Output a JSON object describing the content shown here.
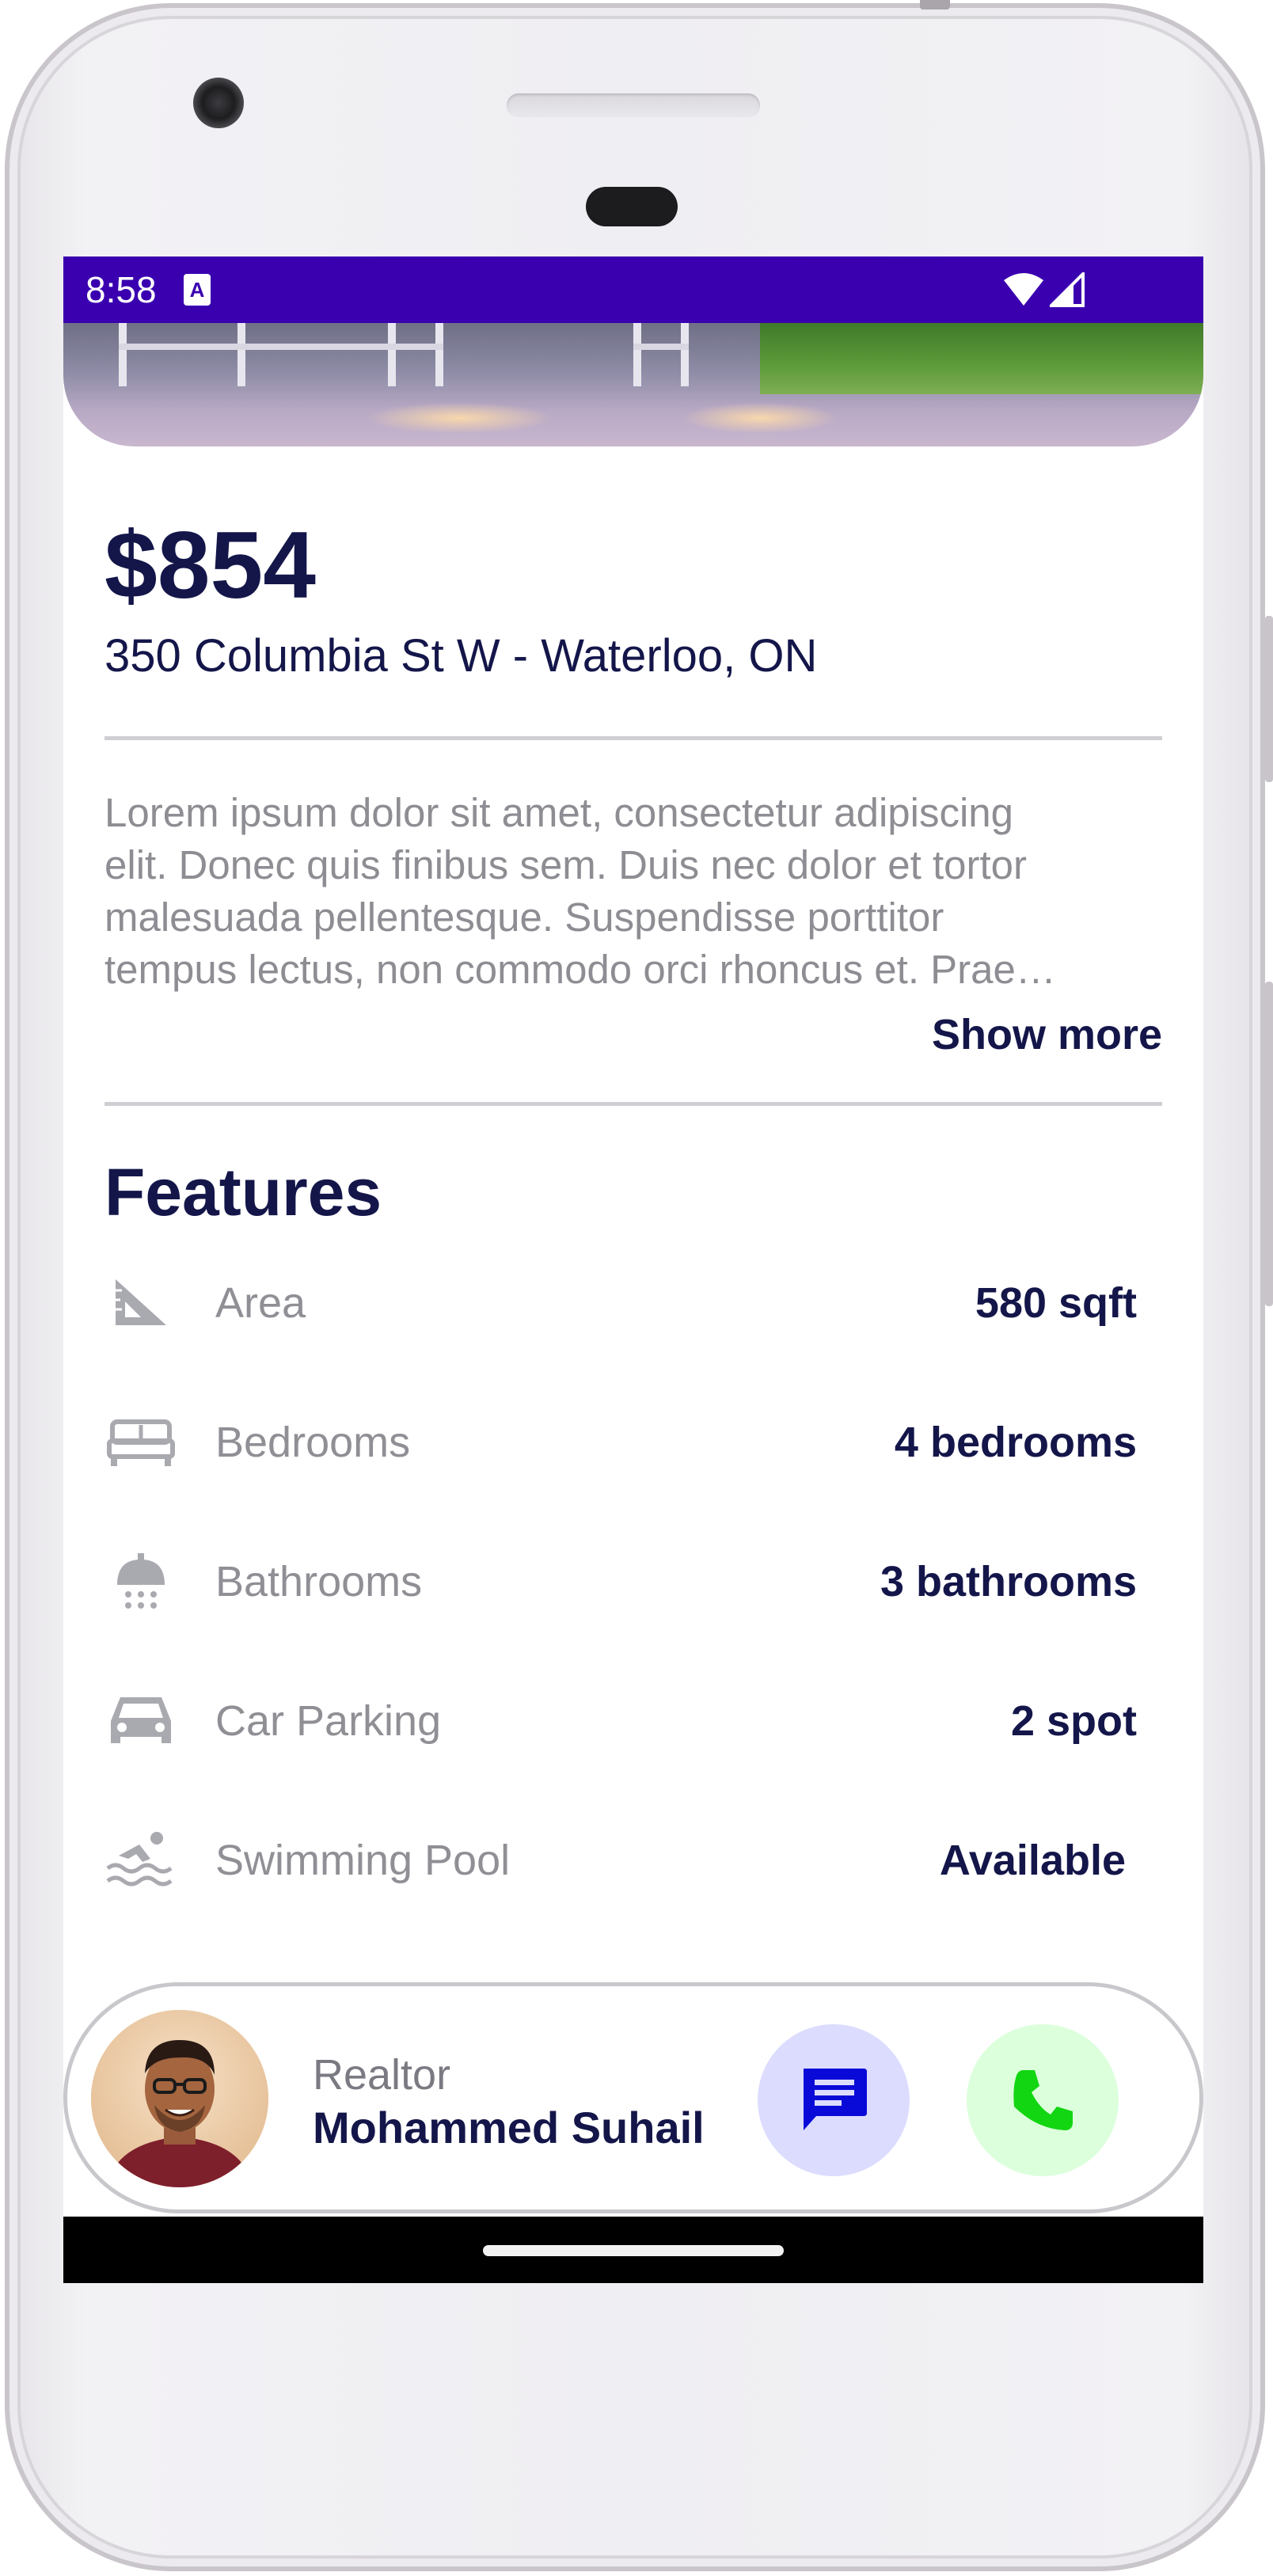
{
  "status_bar": {
    "time": "8:58",
    "notification_icon": "a-box-icon",
    "wifi_icon": "wifi-icon",
    "signal_icon": "cell-signal-icon",
    "background": "#3a00b0"
  },
  "listing": {
    "price": "$854",
    "address": "350 Columbia St W - Waterloo, ON",
    "description": "Lorem ipsum dolor sit amet, consectetur adipiscing\nelit. Donec quis finibus sem. Duis nec dolor et tortor\nmalesuada pellentesque. Suspendisse porttitor\ntempus lectus, non commodo orci rhoncus et. Prae…",
    "show_more_label": "Show more"
  },
  "features": {
    "title": "Features",
    "items": [
      {
        "icon": "set-square-icon",
        "label": "Area",
        "value": "580 sqft"
      },
      {
        "icon": "bed-icon",
        "label": "Bedrooms",
        "value": "4 bedrooms"
      },
      {
        "icon": "shower-icon",
        "label": "Bathrooms",
        "value": "3 bathrooms"
      },
      {
        "icon": "car-icon",
        "label": "Car Parking",
        "value": "2 spot"
      },
      {
        "icon": "swimming-pool-icon",
        "label": "Swimming Pool",
        "value": "Available"
      }
    ]
  },
  "realtor": {
    "role": "Realtor",
    "name": "Mohammed Suhail",
    "message_icon": "message-icon",
    "call_icon": "phone-icon",
    "message_color": "#0a0ad8",
    "call_color": "#12d612"
  },
  "colors": {
    "primary_text": "#14164a",
    "secondary_text": "#8d8d93",
    "accent": "#3a00b0"
  }
}
